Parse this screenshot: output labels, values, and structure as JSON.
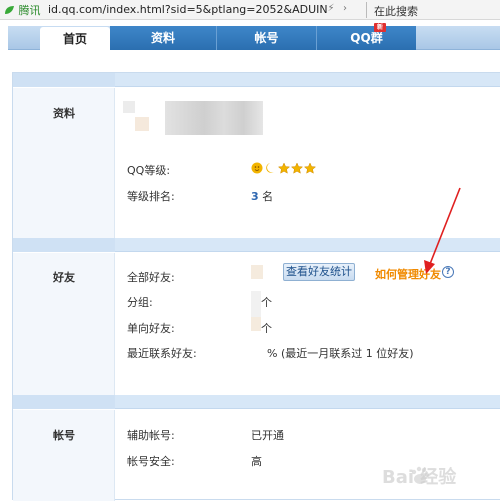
{
  "browser": {
    "brand": "腾讯",
    "url": "id.qq.com/index.html?sid=5&ptlang=2052&ADUIN",
    "search_placeholder": "在此搜索"
  },
  "tabs": [
    {
      "label": "首页",
      "active": true
    },
    {
      "label": "资料",
      "active": false
    },
    {
      "label": "帐号",
      "active": false
    },
    {
      "label": "QQ群",
      "active": false,
      "badge": "新"
    }
  ],
  "profile": {
    "section_title": "资料",
    "qq_level_label": "QQ等级:",
    "level_rank_label": "等级排名:",
    "level_rank_value": "3",
    "level_rank_unit": "名"
  },
  "friends": {
    "section_title": "好友",
    "all_friends_label": "全部好友:",
    "view_stats_button": "查看好友统计",
    "manage_link": "如何管理好友",
    "groups_label": "分组:",
    "groups_unit": "个",
    "one_way_label": "单向好友:",
    "one_way_unit": "个",
    "recent_contacts_label": "最近联系好友:",
    "recent_contacts_value": "% (最近一月联系过 1 位好友)"
  },
  "account": {
    "section_title": "帐号",
    "aux_account_label": "辅助帐号:",
    "aux_account_value": "已开通",
    "security_label": "帐号安全:",
    "security_value": "高"
  },
  "watermark": {
    "text": "Bai 经验"
  },
  "colors": {
    "tab_blue": "#2b6fb0",
    "section_header": "#d7e7f7",
    "link_orange": "#f08a00",
    "rank_blue": "#2e67b1",
    "arrow_red": "#e02020"
  }
}
